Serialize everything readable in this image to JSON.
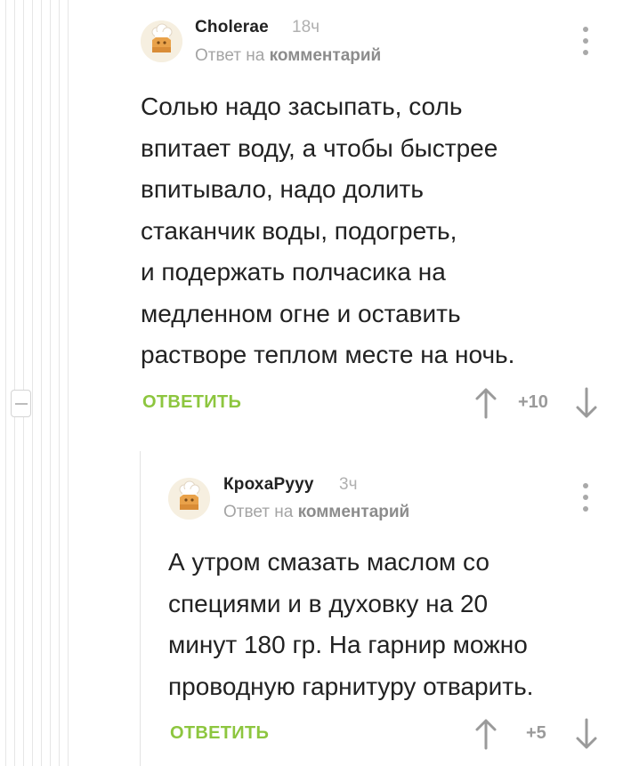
{
  "comment1": {
    "username": "Cholerae",
    "time": "18ч",
    "reply_prefix": "Ответ на",
    "reply_target": "комментарий",
    "body_lines": [
      "Солью надо засыпать, соль",
      "впитает воду, а чтобы быстрее",
      "впитывало, надо долить",
      "стаканчик воды, подогреть,",
      "и подержать полчасика на",
      "медленном огне и оставить",
      "растворе теплом месте на ночь."
    ],
    "reply_button": "ОТВЕТИТЬ",
    "rating": "+10"
  },
  "comment2": {
    "username": "КрохаРууу",
    "time": "3ч",
    "reply_prefix": "Ответ на",
    "reply_target": "комментарий",
    "body_lines": [
      "А утром смазать маслом со",
      "специями и в духовку на 20",
      "минут 180 гр. На гарнир можно",
      "проводную гарнитуру отварить."
    ],
    "reply_button": "ОТВЕТИТЬ",
    "rating": "+5"
  },
  "icons": {
    "avatar": "default-chef-avatar",
    "menu": "vertical-dots-icon",
    "upvote": "arrow-up-icon",
    "downvote": "arrow-down-icon",
    "collapse": "minus-icon"
  },
  "colors": {
    "accent_green": "#8dc63f",
    "muted_gray": "#9a9a9a",
    "text": "#222222"
  }
}
